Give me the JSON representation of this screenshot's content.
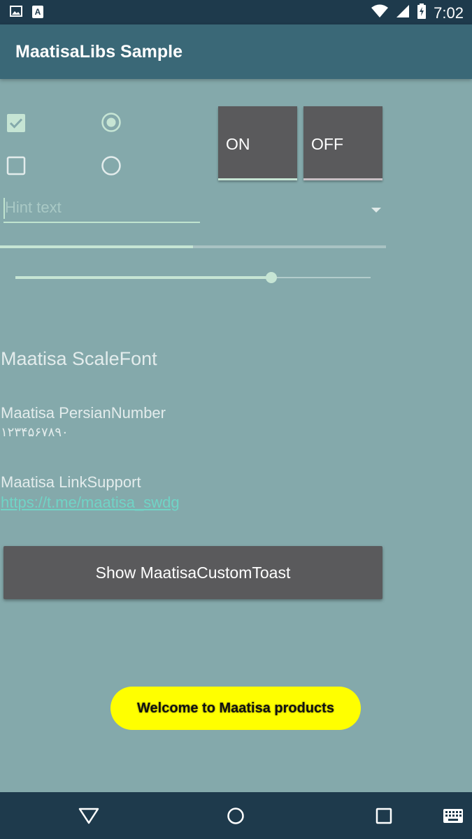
{
  "status_bar": {
    "time": "7:02",
    "left_icons": [
      "image-icon",
      "a-badge-icon"
    ],
    "right_icons": [
      "wifi-icon",
      "signal-icon",
      "battery-charging-icon"
    ]
  },
  "app_bar": {
    "title": "MaatisaLibs Sample"
  },
  "controls": {
    "checkbox_1": {
      "checked": true
    },
    "checkbox_2": {
      "checked": false
    },
    "radio_1": {
      "selected": true
    },
    "radio_2": {
      "selected": false
    },
    "toggle_on_label": "ON",
    "toggle_off_label": "OFF"
  },
  "spinner": {
    "placeholder": "Hint text"
  },
  "progress": {
    "value_percent": 50
  },
  "seekbar": {
    "value_percent": 72
  },
  "labels": {
    "scale_font": "Maatisa ScaleFont",
    "persian_number_label": "Maatisa PersianNumber",
    "persian_digits": "۱۲۳۴۵۶۷۸۹۰",
    "link_support_label": "Maatisa LinkSupport",
    "link_url": "https://t.me/maatisa_swdg"
  },
  "button": {
    "label": "Show MaatisaCustomToast"
  },
  "toast": {
    "text": "Welcome to Maatisa products"
  },
  "colors": {
    "background": "#84a9ab",
    "app_bar": "#3a6877",
    "status_bar": "#1e3a4c",
    "accent": "#c6e5d4",
    "button": "#5a5a5c",
    "toast": "#ffff00",
    "link": "#70d4c6"
  }
}
